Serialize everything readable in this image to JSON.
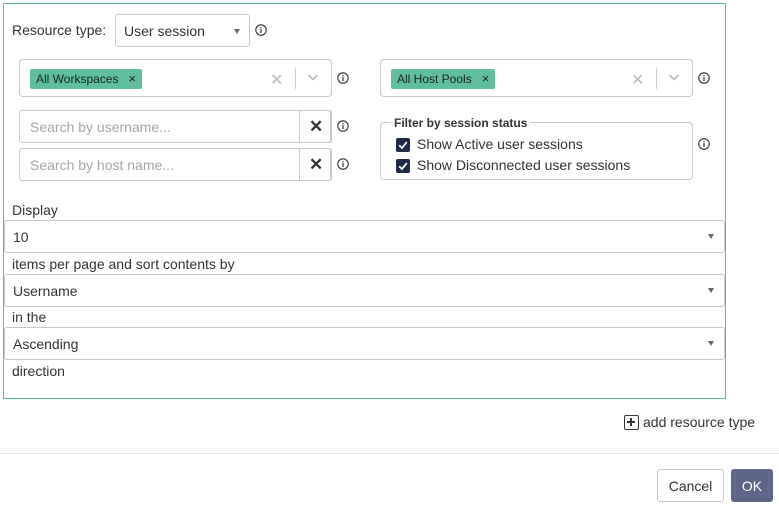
{
  "resource_type": {
    "label": "Resource type:",
    "value": "User session",
    "icon": "info-icon"
  },
  "filters": {
    "workspaces": {
      "tags": [
        "All Workspaces"
      ],
      "clear_icon": "clear-icon",
      "dropdown_icon": "chevron-down-icon"
    },
    "host_pools": {
      "tags": [
        "All Host Pools"
      ],
      "clear_icon": "clear-icon",
      "dropdown_icon": "chevron-down-icon"
    },
    "username_search": {
      "placeholder": "Search by username...",
      "clear_icon": "close-icon"
    },
    "hostname_search": {
      "placeholder": "Search by host name...",
      "clear_icon": "close-icon"
    },
    "session_status": {
      "legend": "Filter by session status",
      "options": [
        {
          "label": "Show Active user sessions",
          "checked": true
        },
        {
          "label": "Show Disconnected user sessions",
          "checked": true
        }
      ]
    }
  },
  "display": {
    "label": "Display",
    "items_per_page": "10",
    "sort_label": "items per page and sort contents by",
    "sort_by": "Username",
    "in_the_label": "in the",
    "direction": "Ascending",
    "direction_label": "direction"
  },
  "add_resource": {
    "label": "add resource type",
    "icon": "plus-square-icon"
  },
  "footer": {
    "cancel_label": "Cancel",
    "ok_label": "OK"
  },
  "colors": {
    "accent_border": "#5fb8a4",
    "tag_bg": "#5fbf9c",
    "ok_button": "#5d6688",
    "checkbox": "#1f2a44"
  }
}
